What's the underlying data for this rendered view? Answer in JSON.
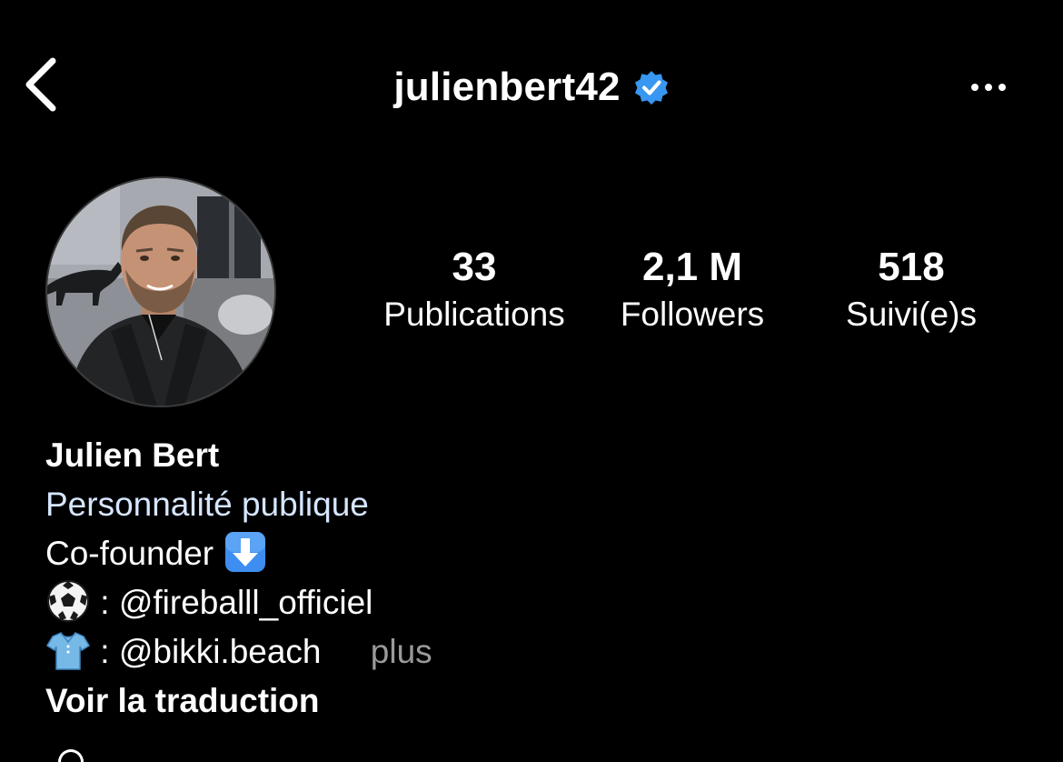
{
  "header": {
    "username": "julienbert42",
    "back_icon": "chevron-left-icon",
    "verified_icon": "verified-badge-icon",
    "more_icon": "more-horizontal-icon"
  },
  "stats": [
    {
      "value": "33",
      "label": "Publications"
    },
    {
      "value": "2,1 M",
      "label": "Followers"
    },
    {
      "value": "518",
      "label": "Suivi(e)s"
    }
  ],
  "bio": {
    "full_name": "Julien Bert",
    "category": "Personnalité publique",
    "line1": "Co-founder",
    "line1_emoji": "arrow-down-emoji",
    "line2_emoji": "soccer-ball-emoji",
    "line2_text": " : ",
    "line2_mention": "@fireballl_officiel",
    "line3_emoji": "tshirt-emoji",
    "line3_text": ": ",
    "line3_mention": "@bikki.beach",
    "more_label": "plus",
    "translate_label": "Voir la traduction"
  },
  "colors": {
    "background": "#000000",
    "text": "#ffffff",
    "category": "#d6e6ff",
    "muted": "#9a9a9a",
    "verified": "#3897f0",
    "emoji_blue": "#3d8ef0"
  }
}
